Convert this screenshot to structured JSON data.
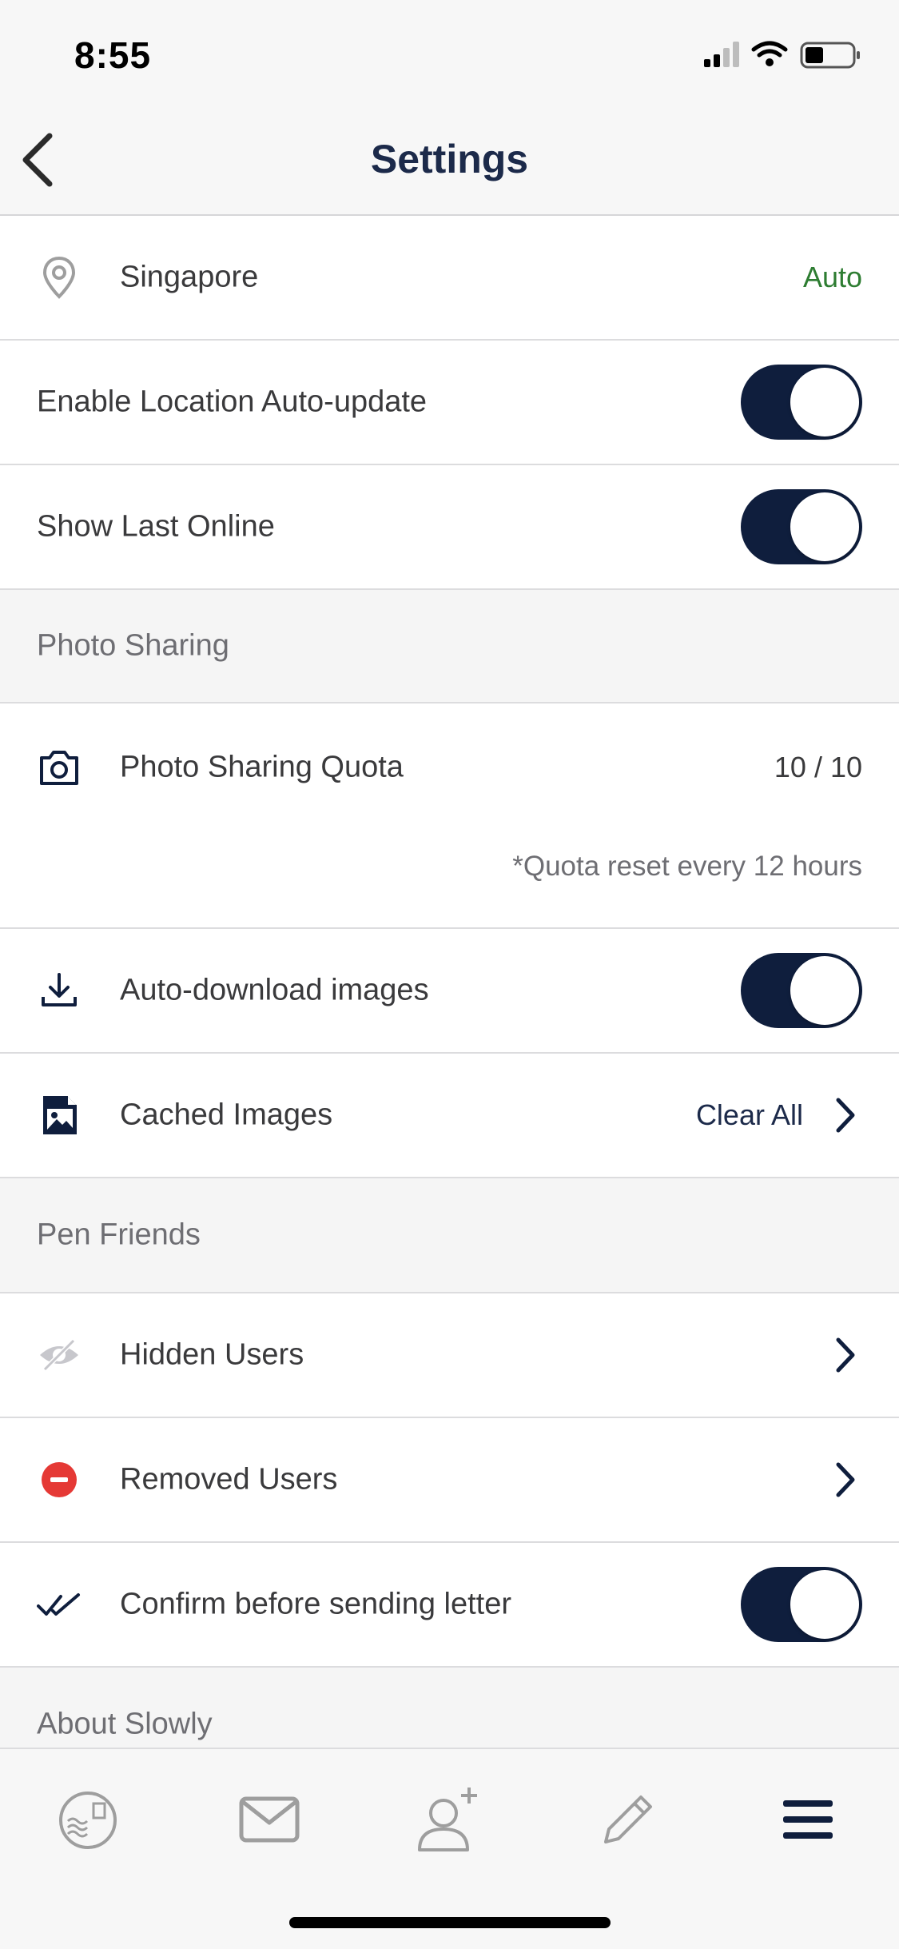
{
  "status": {
    "time": "8:55"
  },
  "nav": {
    "title": "Settings"
  },
  "location": {
    "label": "Singapore",
    "value": "Auto",
    "value_color": "#2e7d32"
  },
  "toggles": {
    "location_auto_update": {
      "label": "Enable Location Auto-update",
      "on": true
    },
    "show_last_online": {
      "label": "Show Last Online",
      "on": true
    }
  },
  "photo_sharing": {
    "header": "Photo Sharing",
    "quota_label": "Photo Sharing Quota",
    "quota_value": "10 / 10",
    "quota_note": "*Quota reset every 12 hours",
    "auto_download_label": "Auto-download images",
    "auto_download_on": true,
    "cached_label": "Cached Images",
    "cached_action": "Clear All"
  },
  "pen_friends": {
    "header": "Pen Friends",
    "hidden_label": "Hidden Users",
    "removed_label": "Removed Users",
    "confirm_label": "Confirm before sending letter",
    "confirm_on": true
  },
  "about": {
    "header": "About Slowly"
  },
  "colors": {
    "accent": "#0f1e3d",
    "danger": "#e53935",
    "icon_gray": "#9e9e9e"
  },
  "tabbar": {
    "tabs": [
      "stamp-icon",
      "mail-icon",
      "add-friend-icon",
      "pencil-icon",
      "menu-icon"
    ]
  }
}
